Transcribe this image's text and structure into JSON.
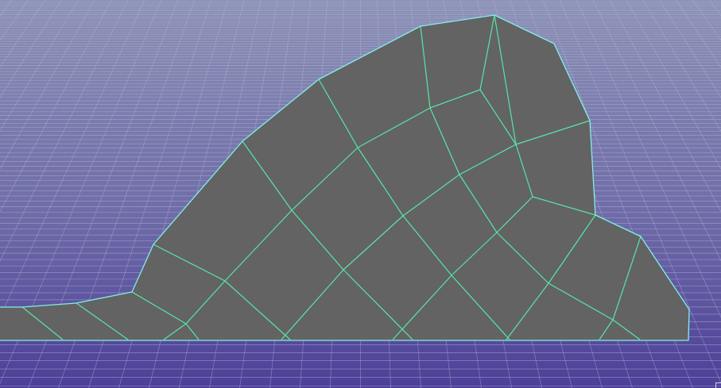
{
  "viewport": {
    "view": "perspective",
    "grid_visible": true
  },
  "colors": {
    "background_top": "#8a8fb4",
    "background_mid": "#6f6ca8",
    "background_bottom": "#4d3f98",
    "grid_line": "#b7b9d8",
    "mesh_fill": "#636363",
    "mesh_edge": "#56e6a8",
    "mesh_border": "#7ff0e8"
  },
  "mesh": {
    "selected": true,
    "display": "shaded-wireframe"
  },
  "icons": {
    "corner": "resize-corner-icon"
  }
}
